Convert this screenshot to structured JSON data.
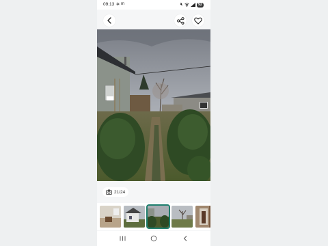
{
  "status_bar": {
    "time": "09:13",
    "battery": "92",
    "icons": [
      "mute-icon",
      "wifi-icon",
      "signal-icon"
    ]
  },
  "toolbar": {
    "back_icon": "chevron-left-icon",
    "share_icon": "share-icon",
    "favorite_icon": "heart-icon"
  },
  "gallery": {
    "counter": "21/24",
    "counter_icon": "camera-icon",
    "thumbnails": [
      {
        "name": "interior-room",
        "selected": false
      },
      {
        "name": "house-yard",
        "selected": false
      },
      {
        "name": "garden-path",
        "selected": true
      },
      {
        "name": "yard-tree",
        "selected": false
      },
      {
        "name": "interior-hall",
        "selected": false
      }
    ]
  },
  "nav_bar": {
    "recents_icon": "recents-icon",
    "home_icon": "home-icon",
    "back_icon": "back-triangle-icon"
  },
  "colors": {
    "accent": "#1f7f6e",
    "background": "#eef0f1"
  }
}
